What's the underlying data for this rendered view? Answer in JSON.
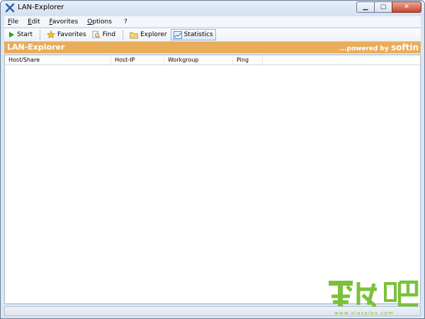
{
  "window": {
    "title": "LAN-Explorer"
  },
  "menu": [
    {
      "label": "File",
      "u": "F",
      "rest": "ile"
    },
    {
      "label": "Edit",
      "u": "E",
      "rest": "dit"
    },
    {
      "label": "Favorites",
      "u": "F",
      "rest": "avorites"
    },
    {
      "label": "Options",
      "u": "O",
      "rest": "ptions"
    },
    {
      "label": "?",
      "u": "",
      "rest": "?"
    }
  ],
  "toolbar": {
    "start": "Start",
    "favorites": "Favorites",
    "find": "Find",
    "explorer": "Explorer",
    "statistics": "Statistics"
  },
  "banner": {
    "title": "LAN-Explorer",
    "powered_prefix": "...powered by ",
    "brand": "softin"
  },
  "columns": [
    "Host/Share",
    "Host-IP",
    "Workgroup",
    "Ping"
  ],
  "watermark_text": "www.xiazaiba.com",
  "colors": {
    "banner": "#e8ad5a",
    "start_icon": "#2a9a2a",
    "watermark": "#7bc13a"
  }
}
